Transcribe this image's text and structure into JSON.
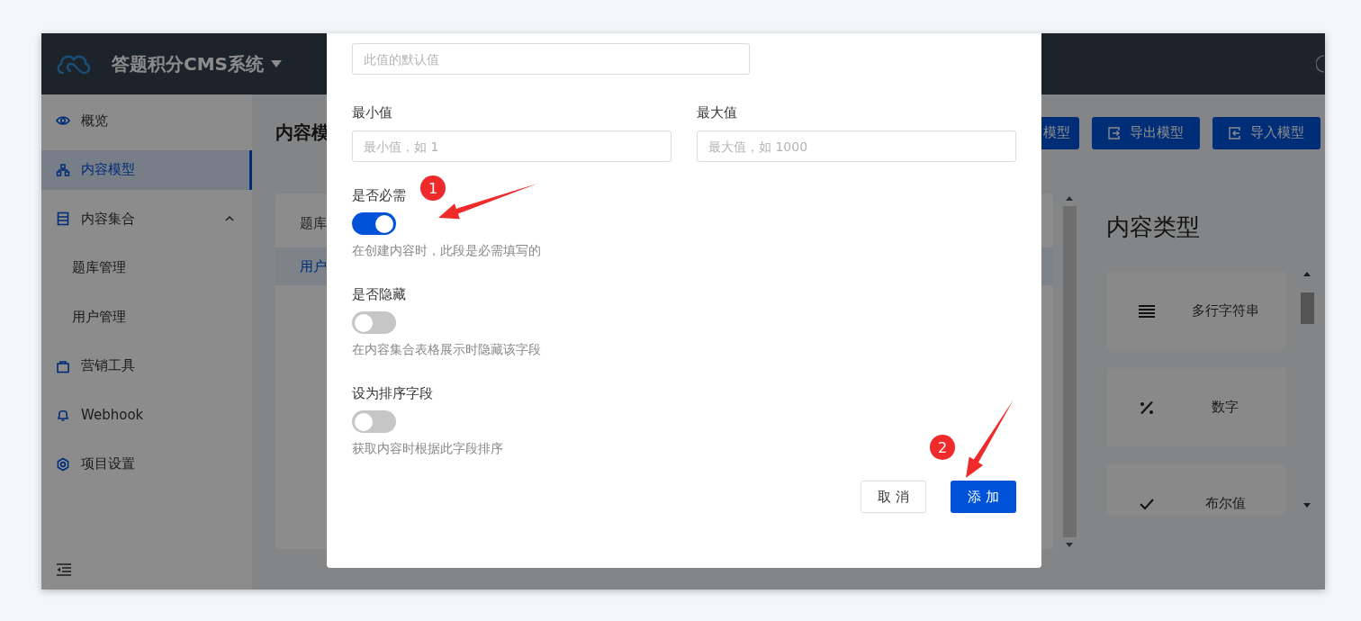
{
  "app": {
    "title": "答题积分CMS系统"
  },
  "sidebar": {
    "items": [
      {
        "label": "概览",
        "selected": false
      },
      {
        "label": "内容模型",
        "selected": true
      },
      {
        "label": "内容集合",
        "selected": false,
        "expanded": true,
        "children": [
          {
            "label": "题库管理",
            "selected": false
          },
          {
            "label": "用户管理",
            "selected": false
          }
        ]
      },
      {
        "label": "营销工具",
        "selected": false
      },
      {
        "label": "Webhook",
        "selected": false
      },
      {
        "label": "项目设置",
        "selected": false
      }
    ]
  },
  "page": {
    "title": "内容模",
    "buttons": [
      "模型",
      "导出模型",
      "导入模型"
    ]
  },
  "model_list": {
    "items": [
      {
        "label": "题库",
        "selected": false
      },
      {
        "label": "用户",
        "selected": true
      }
    ]
  },
  "content_types": {
    "title": "内容类型",
    "items": [
      {
        "label": "多行字符串"
      },
      {
        "label": "数字"
      },
      {
        "label": "布尔值"
      }
    ]
  },
  "dialog": {
    "default_field": {
      "placeholder": "此值的默认值"
    },
    "fields": [
      {
        "label": "最小值",
        "placeholder": "最小值，如 1"
      },
      {
        "label": "最大值",
        "placeholder": "最大值，如 1000"
      }
    ],
    "switches": [
      {
        "label": "是否必需",
        "on": true,
        "hint": "在创建内容时，此段是必需填写的"
      },
      {
        "label": "是否隐藏",
        "on": false,
        "hint": "在内容集合表格展示时隐藏该字段"
      },
      {
        "label": "设为排序字段",
        "on": false,
        "hint": "获取内容时根据此字段排序"
      }
    ],
    "buttons": [
      {
        "label": "取 消",
        "kind": "secondary"
      },
      {
        "label": "添 加",
        "kind": "primary"
      }
    ]
  },
  "annotations": [
    {
      "number": "1"
    },
    {
      "number": "2"
    }
  ]
}
